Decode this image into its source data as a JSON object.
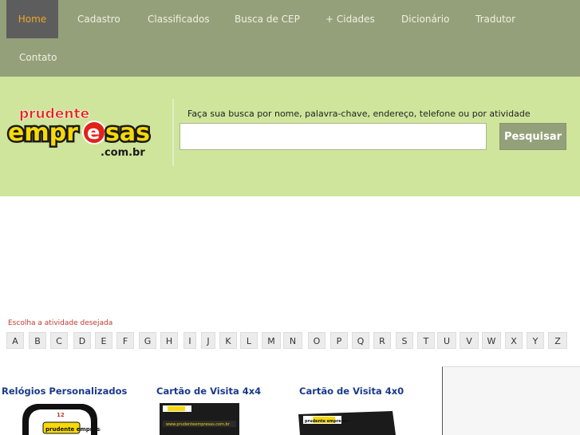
{
  "nav": {
    "items": [
      {
        "label": "Home",
        "active": true
      },
      {
        "label": "Cadastro"
      },
      {
        "label": "Classificados"
      },
      {
        "label": "Busca de CEP"
      },
      {
        "label": "+ Cidades"
      },
      {
        "label": "Dicionário"
      },
      {
        "label": "Tradutor"
      },
      {
        "label": "Contato"
      }
    ]
  },
  "logo": {
    "word1": "prudente",
    "word2_a": "empr",
    "word2_b": "e",
    "word2_c": "sas",
    "word3": ".com.br"
  },
  "search": {
    "label": "Faça sua busca por nome, palavra-chave, endereço, telefone ou por atividade",
    "value": "",
    "button": "Pesquisar"
  },
  "activity": {
    "prompt": "Escolha a atividade desejada",
    "letters": [
      "A",
      "B",
      "C",
      "D",
      "E",
      "F",
      "G",
      "H",
      "I",
      "J",
      "K",
      "L",
      "M",
      "N",
      "O",
      "P",
      "Q",
      "R",
      "S",
      "T",
      "U",
      "V",
      "W",
      "X",
      "Y",
      "Z"
    ]
  },
  "products": [
    {
      "title": "Relógios Personalizados",
      "image": "clock-image",
      "img_text": "prudente empresas",
      "img_num": "12"
    },
    {
      "title": "Cartão de Visita 4x4",
      "image": "business-card-image",
      "img_text": "www.prudenteempresas.com.br"
    },
    {
      "title": "Cartão de Visita 4x0",
      "image": "business-card-image",
      "img_text": "prudente empresas"
    }
  ],
  "colors": {
    "nav_bg": "#94a07a",
    "nav_active_bg": "#5d5d5d",
    "nav_active_text": "#f0a82a",
    "banner_bg": "#cfe59b",
    "button_bg": "#94a07a",
    "logo_red": "#e2231a",
    "logo_yellow": "#f5d90a",
    "product_title": "#1a3a8a",
    "prompt_red": "#c0392b"
  }
}
